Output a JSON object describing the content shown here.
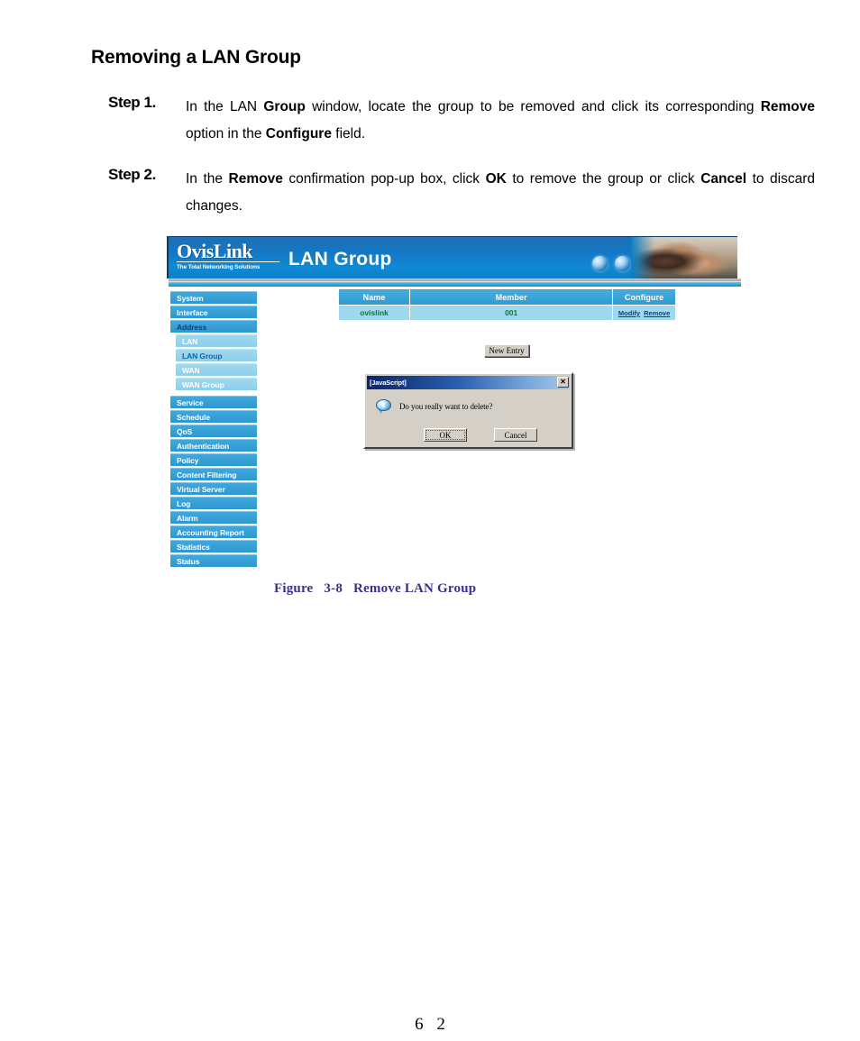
{
  "document": {
    "heading": "Removing a LAN Group",
    "page_number": "6 2",
    "figure_caption": {
      "label": "Figure",
      "number": "3-8",
      "title": "Remove LAN Group"
    },
    "steps": [
      {
        "label": "Step 1.",
        "parts": [
          {
            "text": "In the LAN ",
            "bold": false
          },
          {
            "text": "Group",
            "bold": true
          },
          {
            "text": " window, locate the group to be removed and click its corresponding ",
            "bold": false
          },
          {
            "text": "Remove",
            "bold": true
          },
          {
            "text": " option in the ",
            "bold": false
          },
          {
            "text": "Configure",
            "bold": true
          },
          {
            "text": " field.",
            "bold": false
          }
        ]
      },
      {
        "label": "Step 2.",
        "parts": [
          {
            "text": "In the ",
            "bold": false
          },
          {
            "text": "Remove",
            "bold": true
          },
          {
            "text": " confirmation pop-up box, click ",
            "bold": false
          },
          {
            "text": "OK",
            "bold": true
          },
          {
            "text": " to remove the group or click ",
            "bold": false
          },
          {
            "text": "Cancel",
            "bold": true
          },
          {
            "text": " to discard changes.",
            "bold": false
          }
        ]
      }
    ]
  },
  "screenshot": {
    "banner": {
      "logo_main": "OvisLink",
      "logo_tagline": "The Total Networking Solutions",
      "title": "LAN Group",
      "globe_icons": [
        "globe-icon",
        "globe-icon",
        "globe-icon"
      ],
      "photo_alt": "man-and-child-at-computer-photo"
    },
    "sidebar": {
      "items": [
        {
          "label": "System",
          "level": "top",
          "active": false
        },
        {
          "label": "Interface",
          "level": "top",
          "active": false
        },
        {
          "label": "Address",
          "level": "top",
          "active": true
        },
        {
          "label": "LAN",
          "level": "sub",
          "active": false
        },
        {
          "label": "LAN Group",
          "level": "sub",
          "active": true
        },
        {
          "label": "WAN",
          "level": "sub",
          "active": false
        },
        {
          "label": "WAN Group",
          "level": "sub",
          "active": false
        },
        {
          "label": "Service",
          "level": "top",
          "active": false
        },
        {
          "label": "Schedule",
          "level": "top",
          "active": false
        },
        {
          "label": "QoS",
          "level": "top",
          "active": false
        },
        {
          "label": "Authentication",
          "level": "top",
          "active": false
        },
        {
          "label": "Policy",
          "level": "top",
          "active": false
        },
        {
          "label": "Content Filtering",
          "level": "top",
          "active": false
        },
        {
          "label": "Virtual Server",
          "level": "top",
          "active": false
        },
        {
          "label": "Log",
          "level": "top",
          "active": false
        },
        {
          "label": "Alarm",
          "level": "top",
          "active": false
        },
        {
          "label": "Accounting Report",
          "level": "top",
          "active": false
        },
        {
          "label": "Statistics",
          "level": "top",
          "active": false
        },
        {
          "label": "Status",
          "level": "top",
          "active": false
        }
      ]
    },
    "table": {
      "columns": [
        "Name",
        "Member",
        "Configure"
      ],
      "rows": [
        {
          "name": "ovislink",
          "member": "001",
          "configure": [
            "Modify",
            "Remove"
          ]
        }
      ]
    },
    "new_entry_button": "New Entry",
    "dialog": {
      "title": "[JavaScript]",
      "close_icon": "close-icon",
      "icon": "info-icon",
      "message": "Do you really want to delete?",
      "ok_label": "OK",
      "cancel_label": "Cancel"
    },
    "colors": {
      "banner_blue": "#0f8ad4",
      "nav_blue": "#2e97d0",
      "nav_sub_blue": "#8ccfec",
      "table_header": "#2f9ad2",
      "table_row": "#9fd8ef",
      "row_text_green": "#0d7a2f",
      "link_blue": "#10407a",
      "caption_purple": "#3b3288",
      "dialog_face": "#d4d0c8"
    }
  }
}
